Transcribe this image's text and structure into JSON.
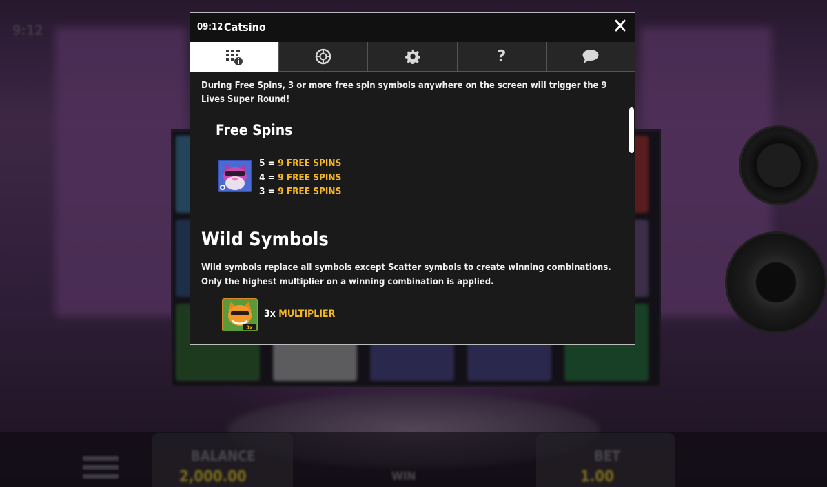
{
  "background": {
    "clock": "9:12",
    "balance_label": "BALANCE",
    "balance_value": "2,000.00",
    "win_label": "WIN",
    "bet_label": "BET",
    "bet_value": "1.00"
  },
  "dialog": {
    "time": "09:12",
    "title": "Catsino",
    "close_glyph": "✕",
    "tabs": [
      {
        "icon": "paytable-info-icon",
        "active": true
      },
      {
        "icon": "chip-icon",
        "active": false
      },
      {
        "icon": "gear-icon",
        "active": false
      },
      {
        "icon": "question-icon",
        "active": false
      },
      {
        "icon": "chat-bubble-icon",
        "active": false
      }
    ],
    "intro_text": "During Free Spins, 3 or more free spin symbols anywhere on the screen will trigger the 9 Lives Super Round!",
    "free_spins": {
      "heading": "Free Spins",
      "payouts": [
        {
          "count": "5 = ",
          "value": "9 FREE SPINS"
        },
        {
          "count": "4 = ",
          "value": "9 FREE SPINS"
        },
        {
          "count": "3 = ",
          "value": "9 FREE SPINS"
        }
      ]
    },
    "wild": {
      "heading": "Wild Symbols",
      "description": "Wild symbols replace all symbols except Scatter symbols to create winning combinations. Only the highest multiplier on a winning combination is applied.",
      "multiplier_count": "3x ",
      "multiplier_label": "MULTIPLIER"
    }
  },
  "colors": {
    "accent_gold": "#f5b825",
    "dialog_bg": "#1a1a1a",
    "tab_bg": "#262626"
  }
}
